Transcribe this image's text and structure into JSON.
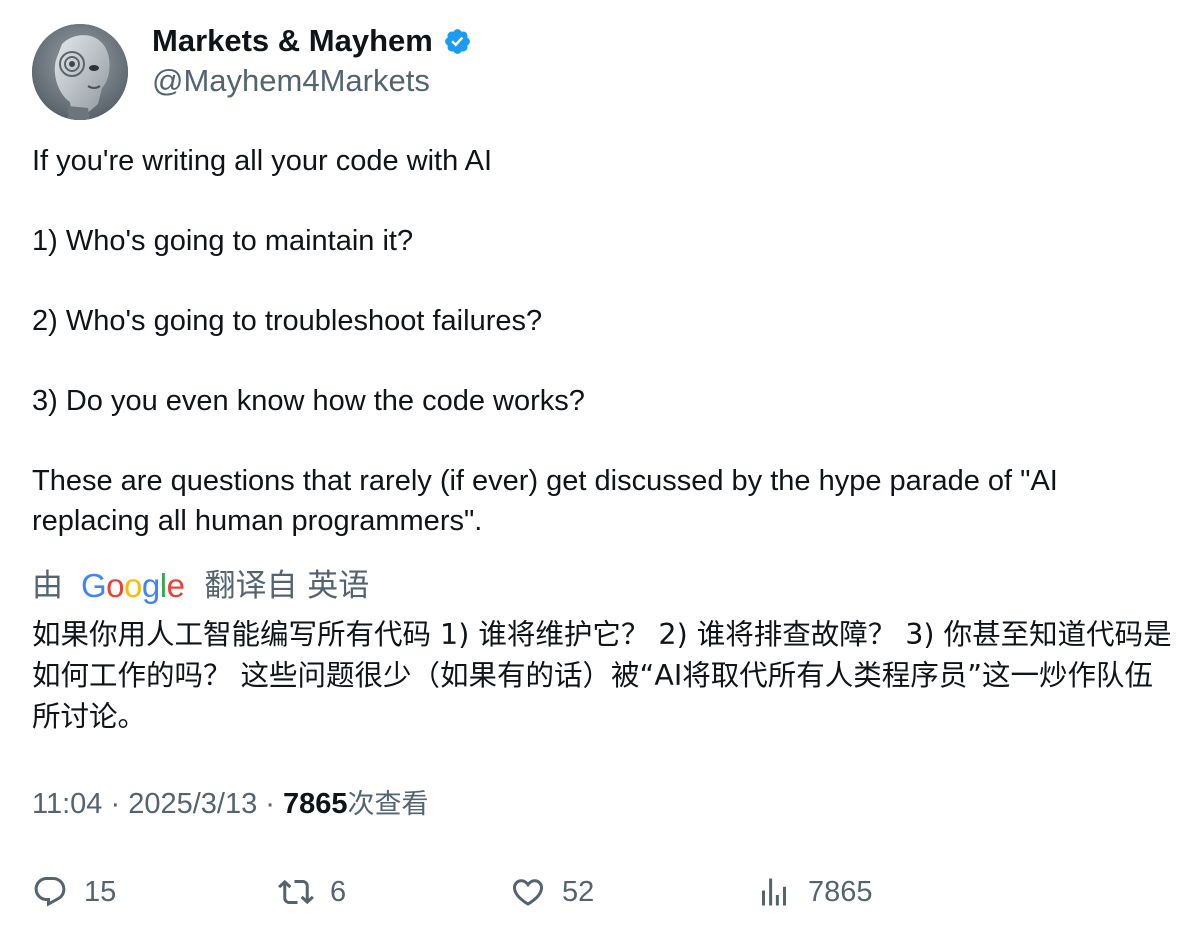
{
  "author": {
    "name": "Markets & Mayhem",
    "handle": "@Mayhem4Markets",
    "verified_color": "#1d9bf0"
  },
  "tweet": {
    "lines": [
      "If you're writing all your code with AI",
      "1) Who's going to maintain it?",
      "2) Who's going to troubleshoot failures?",
      "3) Do you even know how the code works?",
      "These are questions that rarely (if ever) get discussed by the hype parade of \"AI",
      "replacing all human programmers\"."
    ]
  },
  "translation": {
    "prefix": "由",
    "provider": "Google",
    "suffix": "翻译自 英语",
    "text": "如果你用人工智能编写所有代码 1) 谁将维护它？ 2) 谁将排查故障？ 3) 你甚至知道代码是如何工作的吗？ 这些问题很少（如果有的话）被“AI将取代所有人类程序员”这一炒作队伍所讨论。"
  },
  "meta": {
    "time": "11:04",
    "separator": "·",
    "date": "2025/3/13",
    "views_count": "7865",
    "views_label": "次查看"
  },
  "actions": {
    "replies": "15",
    "retweets": "6",
    "likes": "52",
    "views": "7865"
  },
  "colors": {
    "text_primary": "#0f1419",
    "text_secondary": "#536471",
    "google_blue": "#4285f4",
    "google_red": "#ea4335",
    "google_yellow": "#fbbc05",
    "google_green": "#34a853"
  }
}
